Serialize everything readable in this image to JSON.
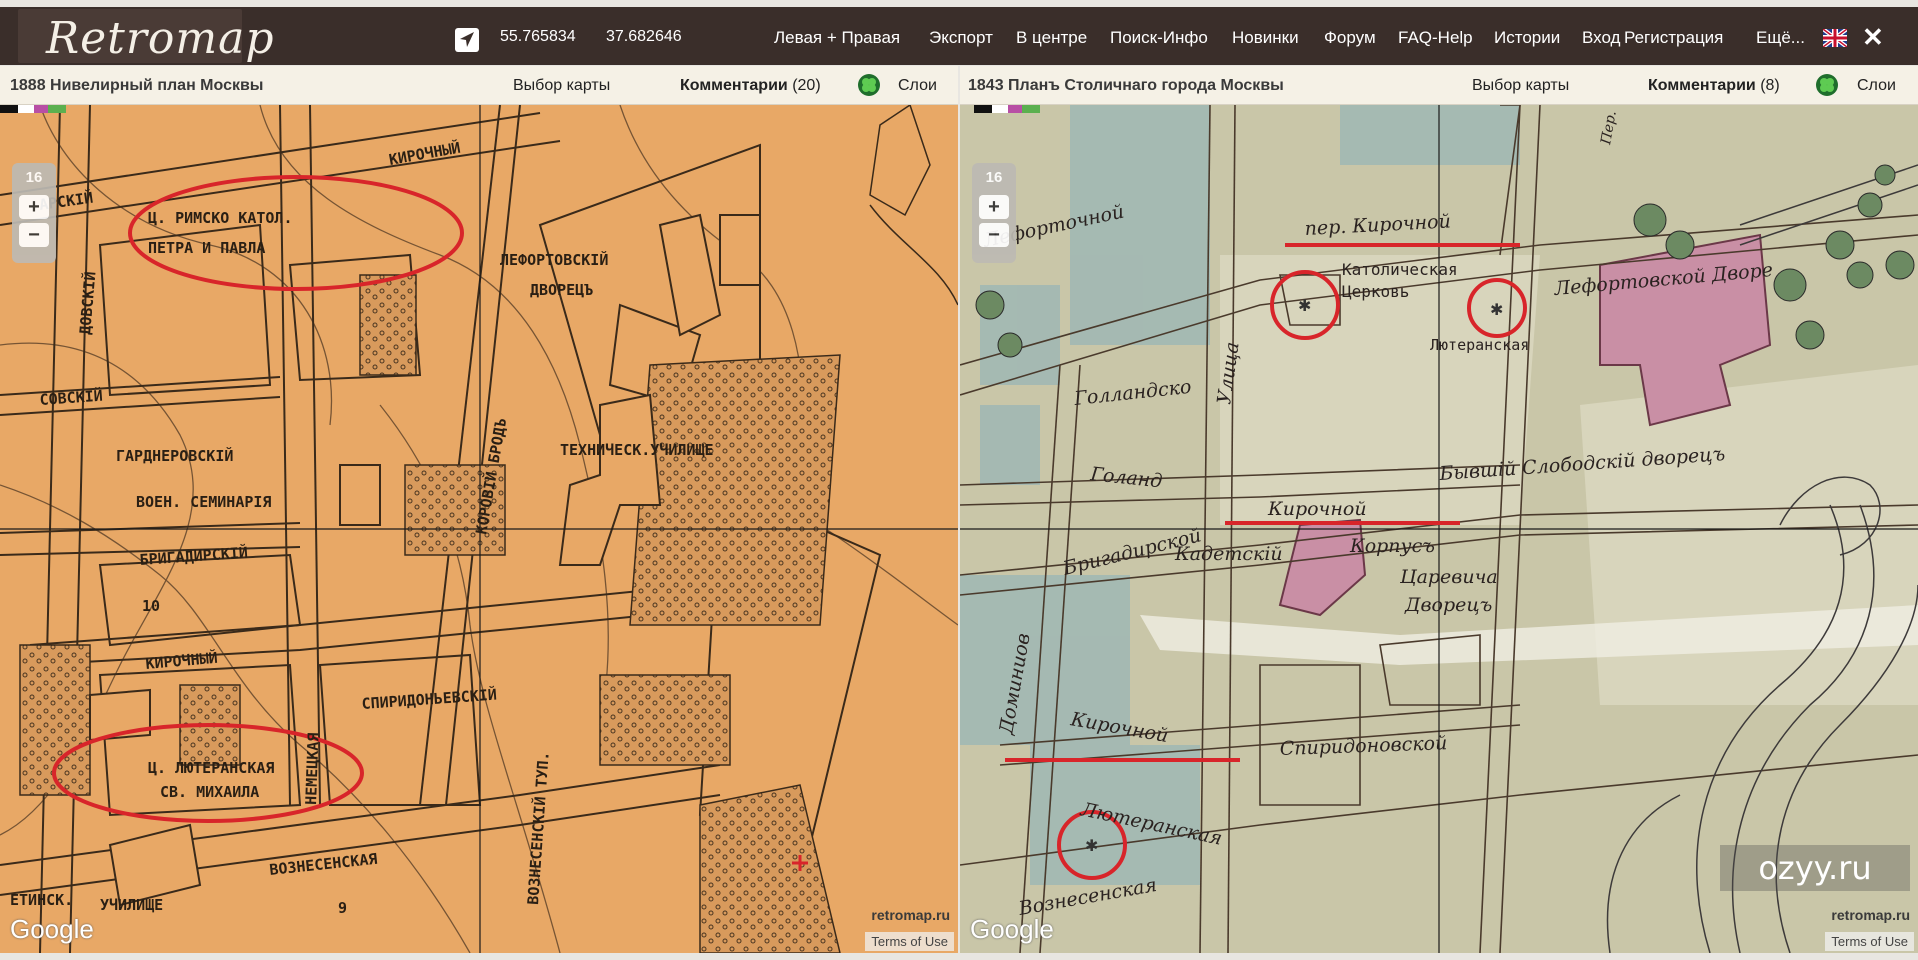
{
  "topbar": {
    "logo": "Retromap",
    "lat": "55.765834",
    "lon": "37.682646",
    "menu": [
      "Левая + Правая",
      "Экспорт",
      "В центре",
      "Поиск-Инфо",
      "Новинки",
      "Форум",
      "FAQ-Help",
      "Истории",
      "Вход",
      "Регистрация",
      "Ещё..."
    ],
    "close": "✕"
  },
  "left": {
    "title": "1888 Нивелирный план Москвы",
    "choose_map": "Выбор карты",
    "comments_label": "Комментарии",
    "comments_count": "(20)",
    "layers": "Слои",
    "zoom": "16",
    "map_labels": [
      "КИРОЧНЫЙ",
      "Ц. РИМСКО КАТОЛ.",
      "ПЕТРА И ПАВЛА",
      "ЛЕФОРТОВСКІЙ",
      "ДВОРЕЦЪ",
      "ДОВСКІЙ",
      "СОВСКІЙ",
      "ГАРДНЕРОВСКІЙ",
      "ВОЕН. СЕМИНАРІЯ",
      "ТЕХНИЧЕСК.УЧИЛИЩЕ",
      "КОРОВІЙ БРОДЪ",
      "БРИГАДИРСКІЙ",
      "10",
      "КИРОЧНЫЙ",
      "НЕМЕЦКАЯ",
      "СПИРИДОНЬЕВСКІЙ",
      "ВОЗНЕСЕНСКІЙ ТУП.",
      "Ц. ЛЮТЕРАНСКАЯ",
      "СВ. МИХАИЛА",
      "ВОЗНЕСЕНСКАЯ",
      "9",
      "ЕТИНСК.",
      "УЧИЛИЩЕ",
      "АРСКІЙ"
    ]
  },
  "right": {
    "title": "1843 Планъ Столичнаго города Москвы",
    "choose_map": "Выбор карты",
    "comments_label": "Комментарии",
    "comments_count": "(8)",
    "layers": "Слои",
    "zoom": "16",
    "map_labels": [
      "пер. Кирочной",
      "Католическая",
      "Церковь",
      "Лефортовской Дворе",
      "Лютеранская",
      "Лефорточной",
      "Улица",
      "Голландско",
      "Голанд",
      "Бывшій Слободскій дворецъ",
      "Кирочной",
      "Кадетскій",
      "Корпусъ",
      "Царевича",
      "Дворецъ",
      "Бригадирской",
      "Доминиов",
      "Кирочной",
      "Спиридоновской",
      "Лютеранская",
      "Вознесенская",
      "Пер."
    ]
  },
  "footer": {
    "google": "Google",
    "retromap": "retromap.ru",
    "terms": "Terms of Use",
    "watermark": "ozyy.ru"
  },
  "colors": {
    "topbar": "#3a2e2a",
    "left_map_bg": "#e8a866",
    "right_map_bg": "#c9c6a8",
    "annotation_red": "#d8252a"
  },
  "icons": {
    "nav": "navigation-arrow-icon",
    "flag": "uk-flag-icon",
    "layers": "clover-layers-icon"
  }
}
